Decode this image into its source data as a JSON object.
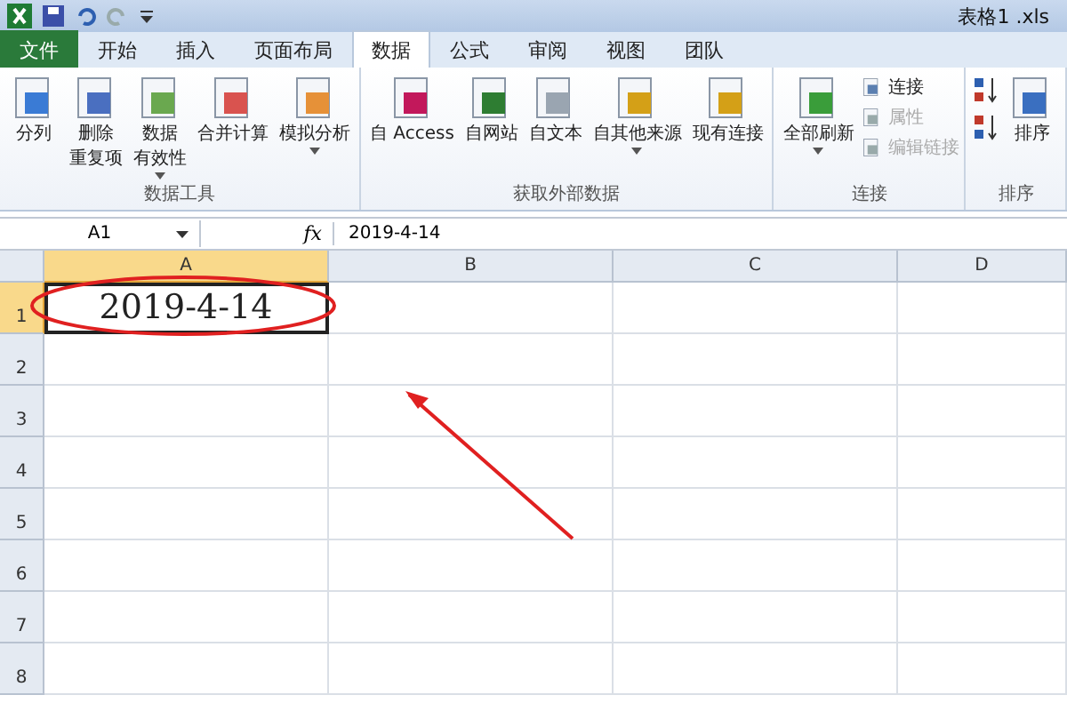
{
  "title_bar": {
    "title": "表格1 .xls"
  },
  "tabs": [
    {
      "label": "文件",
      "kind": "file",
      "selected": false
    },
    {
      "label": "开始",
      "kind": "tab",
      "selected": false
    },
    {
      "label": "插入",
      "kind": "tab",
      "selected": false
    },
    {
      "label": "页面布局",
      "kind": "tab",
      "selected": false
    },
    {
      "label": "数据",
      "kind": "tab",
      "selected": true
    },
    {
      "label": "公式",
      "kind": "tab",
      "selected": false
    },
    {
      "label": "审阅",
      "kind": "tab",
      "selected": false
    },
    {
      "label": "视图",
      "kind": "tab",
      "selected": false
    },
    {
      "label": "团队",
      "kind": "tab",
      "selected": false
    }
  ],
  "ribbon_groups": [
    {
      "label": "数据工具",
      "buttons": [
        {
          "kind": "large",
          "lines": [
            "分列"
          ],
          "dropdown": false
        },
        {
          "kind": "large",
          "lines": [
            "删除",
            "重复项"
          ],
          "dropdown": false
        },
        {
          "kind": "large",
          "lines": [
            "数据",
            "有效性"
          ],
          "dropdown": true
        },
        {
          "kind": "large",
          "lines": [
            "合并计算"
          ],
          "dropdown": false
        },
        {
          "kind": "large",
          "lines": [
            "模拟分析"
          ],
          "dropdown": true
        }
      ]
    },
    {
      "label": "获取外部数据",
      "buttons": [
        {
          "kind": "large",
          "lines": [
            "自 Access"
          ],
          "dropdown": false
        },
        {
          "kind": "large",
          "lines": [
            "自网站"
          ],
          "dropdown": false
        },
        {
          "kind": "large",
          "lines": [
            "自文本"
          ],
          "dropdown": false
        },
        {
          "kind": "large",
          "lines": [
            "自其他来源"
          ],
          "dropdown": true
        },
        {
          "kind": "large",
          "lines": [
            "现有连接"
          ],
          "dropdown": false
        }
      ]
    },
    {
      "label": "连接",
      "buttons": [
        {
          "kind": "large",
          "lines": [
            "全部刷新"
          ],
          "dropdown": true
        },
        {
          "kind": "small",
          "lines": [
            "连接"
          ],
          "disabled": false
        },
        {
          "kind": "small",
          "lines": [
            "属性"
          ],
          "disabled": true
        },
        {
          "kind": "small",
          "lines": [
            "编辑链接"
          ],
          "disabled": true
        }
      ]
    },
    {
      "label": "排序",
      "buttons": [
        {
          "kind": "sortpair"
        },
        {
          "kind": "large",
          "lines": [
            "排序"
          ],
          "dropdown": false
        }
      ]
    }
  ],
  "formula_bar": {
    "name_box": "A1",
    "fx": "fx",
    "value": "2019-4-14"
  },
  "sheet": {
    "columns": [
      {
        "label": "A",
        "selected": true
      },
      {
        "label": "B",
        "selected": false
      },
      {
        "label": "C",
        "selected": false
      },
      {
        "label": "D",
        "selected": false
      }
    ],
    "rows": [
      {
        "label": "1",
        "selected": true,
        "cells": [
          "2019-4-14",
          "",
          "",
          ""
        ]
      },
      {
        "label": "2",
        "selected": false,
        "cells": [
          "",
          "",
          "",
          ""
        ]
      },
      {
        "label": "3",
        "selected": false,
        "cells": [
          "",
          "",
          "",
          ""
        ]
      },
      {
        "label": "4",
        "selected": false,
        "cells": [
          "",
          "",
          "",
          ""
        ]
      },
      {
        "label": "5",
        "selected": false,
        "cells": [
          "",
          "",
          "",
          ""
        ]
      },
      {
        "label": "6",
        "selected": false,
        "cells": [
          "",
          "",
          "",
          ""
        ]
      },
      {
        "label": "7",
        "selected": false,
        "cells": [
          "",
          "",
          "",
          ""
        ]
      },
      {
        "label": "8",
        "selected": false,
        "cells": [
          "",
          "",
          "",
          ""
        ]
      }
    ]
  },
  "annotations": {
    "ellipse": true,
    "arrow": true
  }
}
